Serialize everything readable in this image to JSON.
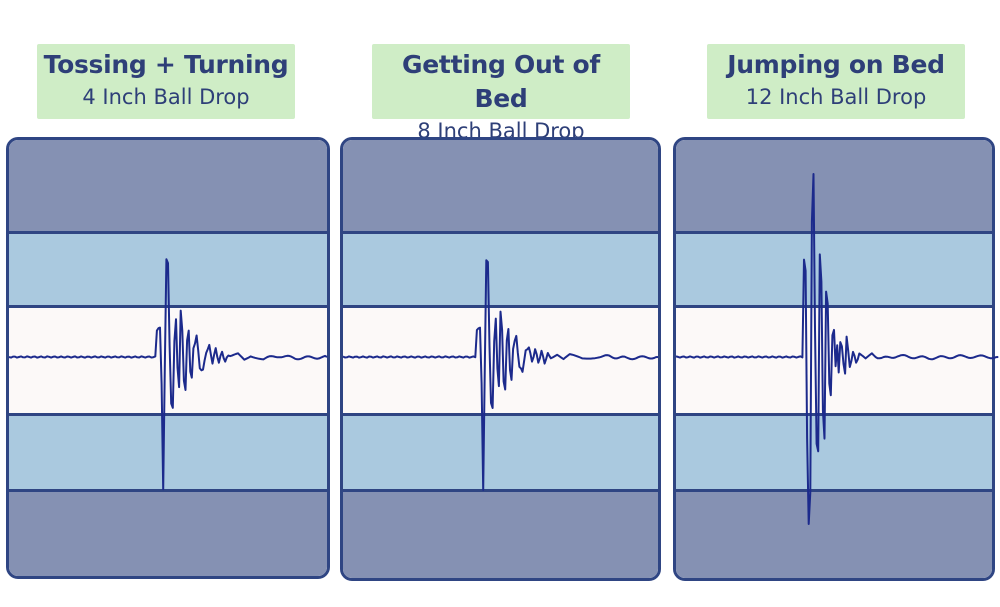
{
  "panels": [
    {
      "title": "Tossing + Turning",
      "subtitle": "4 Inch Ball Drop",
      "waveform": {
        "onset": 0.46,
        "points": [
          [
            0,
            0
          ],
          [
            0.46,
            0
          ],
          [
            0.465,
            0.5
          ],
          [
            0.475,
            0.55
          ],
          [
            0.48,
            -0.5
          ],
          [
            0.485,
            -2.45
          ],
          [
            0.49,
            -0.2
          ],
          [
            0.495,
            1.8
          ],
          [
            0.5,
            1.75
          ],
          [
            0.505,
            0.2
          ],
          [
            0.51,
            -0.85
          ],
          [
            0.515,
            -0.95
          ],
          [
            0.52,
            0.3
          ],
          [
            0.525,
            0.7
          ],
          [
            0.53,
            -0.2
          ],
          [
            0.535,
            -0.55
          ],
          [
            0.54,
            0.85
          ],
          [
            0.545,
            0.5
          ],
          [
            0.55,
            -0.45
          ],
          [
            0.555,
            -0.6
          ],
          [
            0.56,
            0.3
          ],
          [
            0.565,
            0.5
          ],
          [
            0.57,
            -0.25
          ],
          [
            0.575,
            -0.4
          ],
          [
            0.58,
            0.15
          ],
          [
            0.59,
            0.4
          ],
          [
            0.6,
            -0.2
          ],
          [
            0.61,
            -0.25
          ],
          [
            0.62,
            0.1
          ],
          [
            0.63,
            0.2
          ],
          [
            0.64,
            -0.1
          ],
          [
            0.65,
            0.15
          ],
          [
            0.66,
            -0.1
          ],
          [
            0.67,
            0.1
          ],
          [
            0.68,
            -0.1
          ],
          [
            0.69,
            0.05
          ],
          [
            0.7,
            0
          ],
          [
            0.72,
            0.05
          ],
          [
            0.74,
            -0.05
          ],
          [
            0.76,
            0.03
          ],
          [
            0.8,
            -0.03
          ],
          [
            0.85,
            0.02
          ],
          [
            0.9,
            -0.02
          ],
          [
            1,
            0
          ]
        ]
      }
    },
    {
      "title": "Getting Out of Bed",
      "subtitle": "8 Inch Ball Drop",
      "waveform": {
        "onset": 0.42,
        "points": [
          [
            0,
            0
          ],
          [
            0.42,
            0
          ],
          [
            0.425,
            0.5
          ],
          [
            0.435,
            0.55
          ],
          [
            0.44,
            -0.5
          ],
          [
            0.445,
            -2.45
          ],
          [
            0.45,
            -0.2
          ],
          [
            0.455,
            1.8
          ],
          [
            0.46,
            1.75
          ],
          [
            0.465,
            0.2
          ],
          [
            0.47,
            -0.85
          ],
          [
            0.475,
            -0.95
          ],
          [
            0.48,
            0.3
          ],
          [
            0.485,
            0.7
          ],
          [
            0.49,
            -0.2
          ],
          [
            0.495,
            -0.55
          ],
          [
            0.5,
            0.85
          ],
          [
            0.505,
            0.5
          ],
          [
            0.51,
            -0.45
          ],
          [
            0.515,
            -0.6
          ],
          [
            0.52,
            0.3
          ],
          [
            0.525,
            0.5
          ],
          [
            0.53,
            -0.25
          ],
          [
            0.535,
            -0.4
          ],
          [
            0.54,
            0.15
          ],
          [
            0.55,
            0.4
          ],
          [
            0.56,
            -0.2
          ],
          [
            0.57,
            -0.25
          ],
          [
            0.58,
            0.1
          ],
          [
            0.59,
            0.2
          ],
          [
            0.6,
            -0.1
          ],
          [
            0.61,
            0.15
          ],
          [
            0.62,
            -0.1
          ],
          [
            0.63,
            0.1
          ],
          [
            0.64,
            -0.1
          ],
          [
            0.65,
            0.05
          ],
          [
            0.66,
            0
          ],
          [
            0.68,
            0.05
          ],
          [
            0.7,
            -0.05
          ],
          [
            0.72,
            0.03
          ],
          [
            0.76,
            -0.03
          ],
          [
            0.82,
            0.02
          ],
          [
            0.9,
            -0.02
          ],
          [
            1,
            0
          ]
        ]
      }
    },
    {
      "title": "Jumping on Bed",
      "subtitle": "12 Inch Ball Drop",
      "waveform": {
        "onset": 0.4,
        "points": [
          [
            0,
            0
          ],
          [
            0.4,
            0
          ],
          [
            0.405,
            1.8
          ],
          [
            0.41,
            1.6
          ],
          [
            0.415,
            -1.5
          ],
          [
            0.42,
            -3.1
          ],
          [
            0.425,
            -2.5
          ],
          [
            0.43,
            2.5
          ],
          [
            0.435,
            3.4
          ],
          [
            0.44,
            0.5
          ],
          [
            0.445,
            -1.6
          ],
          [
            0.45,
            -1.75
          ],
          [
            0.455,
            1.9
          ],
          [
            0.46,
            1.4
          ],
          [
            0.465,
            -1.0
          ],
          [
            0.47,
            -1.5
          ],
          [
            0.475,
            1.2
          ],
          [
            0.48,
            1.0
          ],
          [
            0.485,
            -0.5
          ],
          [
            0.49,
            -0.7
          ],
          [
            0.495,
            0.4
          ],
          [
            0.5,
            0.5
          ],
          [
            0.505,
            -0.15
          ],
          [
            0.51,
            0.2
          ],
          [
            0.515,
            -0.3
          ],
          [
            0.52,
            0.3
          ],
          [
            0.525,
            0.2
          ],
          [
            0.53,
            -0.15
          ],
          [
            0.535,
            -0.3
          ],
          [
            0.54,
            0.4
          ],
          [
            0.55,
            -0.2
          ],
          [
            0.56,
            0.1
          ],
          [
            0.57,
            -0.1
          ],
          [
            0.58,
            0.05
          ],
          [
            0.6,
            -0.05
          ],
          [
            0.62,
            0.05
          ],
          [
            0.65,
            -0.03
          ],
          [
            0.7,
            0.02
          ],
          [
            0.8,
            -0.02
          ],
          [
            0.9,
            0.01
          ],
          [
            1.02,
            0
          ]
        ]
      }
    }
  ],
  "colors": {
    "label_bg": "#cfedc6",
    "label_text": "#2e3f78",
    "band_outer": "#8591b3",
    "band_mid": "#aac9df",
    "band_center": "#fcf9f8",
    "border": "#2f4583",
    "wave": "#1c2a8c"
  }
}
